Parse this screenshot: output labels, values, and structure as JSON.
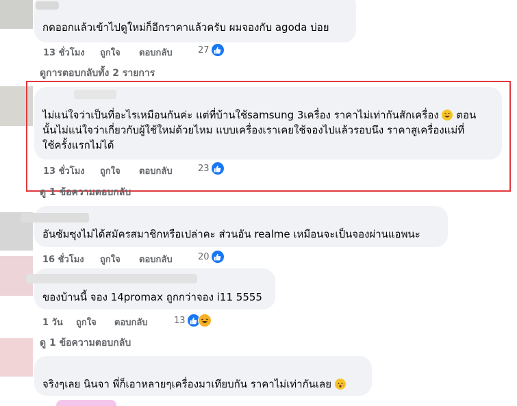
{
  "comments": [
    {
      "text_lines": [
        "กดออกแล้วเข้าไปดูใหม่ก็อีกราคาแล้วครับ ผมจองกับ agoda บ่อย"
      ],
      "time": "13 ชั่วโมง",
      "like_label": "ถูกใจ",
      "reply_label": "ตอบกลับ",
      "reaction_count": "27"
    },
    {
      "text_lines": [
        "ไม่แน่ใจว่าเป็นที่อะไรเหมือนกันค่ะ แต่ที่บ้านใช้samsung 3เครื่อง ราคาไม่เท่ากันสักเครื่อง",
        "นั้นไม่แน่ใจว่าเกี่ยวกับผู้ใช้ใหม่ด้วยไหม แบบเครื่องเราเคยใช้จองไปแล้วรอบนึง ราคาสูเครื่องแม่ที่",
        "ใช้ครั้งแรกไม่ได้"
      ],
      "line1_tail": "ตอน",
      "time": "13 ชั่วโมง",
      "like_label": "ถูกใจ",
      "reply_label": "ตอบกลับ",
      "reaction_count": "23"
    },
    {
      "text_lines": [
        "อันซัมซุงไม่ได้สมัครสมาชิกหรือเปล่าคะ ส่วนอัน realme เหมือนจะเป็นจองผ่านแอพนะ"
      ],
      "time": "16 ชั่วโมง",
      "like_label": "ถูกใจ",
      "reply_label": "ตอบกลับ",
      "reaction_count": "20"
    },
    {
      "text_lines": [
        "ของบ้านนี้ จอง 14promax ถูกกว่าจอง i11 5555"
      ],
      "time": "1 วัน",
      "like_label": "ถูกใจ",
      "reply_label": "ตอบกลับ",
      "reaction_count": "13"
    },
    {
      "text_lines": [
        "จริงๆเลย นินจา พี่ก็เอาหลายๆเครื่องมาเทียบกัน ราคาไม่เท่ากันเลย"
      ]
    }
  ],
  "view_replies": [
    "ดูการตอบกลับทั้ง 2 รายการ",
    "ดู 1 ข้อความตอบกลับ",
    "ดู 1 ข้อความตอบกลับ"
  ],
  "icons": {
    "like": "thumbs-up-icon",
    "haha": "laughing-face-icon",
    "grin": "grinning-sweat-emoji",
    "blush": "blushing-face-emoji"
  },
  "colors": {
    "bubble": "#f0f2f5",
    "meta": "#65676b",
    "like_blue": "#1877f2",
    "highlight_red": "#e0393e"
  }
}
